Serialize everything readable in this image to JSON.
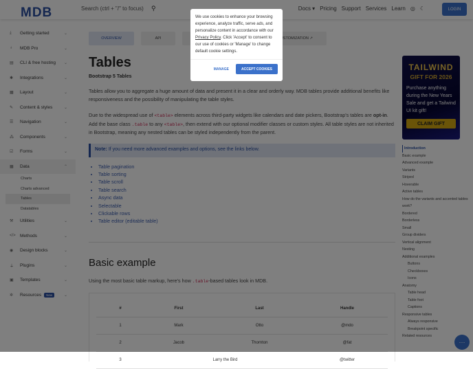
{
  "nav": {
    "logo": "MDB",
    "search_placeholder": "Search (ctrl + \"/\" to focus)",
    "links": [
      "Docs ▾",
      "Pricing",
      "Support",
      "Services",
      "Learn"
    ],
    "login": "LOGIN"
  },
  "sidebar": {
    "items": [
      {
        "label": "Getting started",
        "icon": "⤓"
      },
      {
        "label": "MDB Pro",
        "icon": "♁"
      },
      {
        "label": "CLI & free hosting",
        "icon": "▤"
      },
      {
        "label": "Integrations",
        "icon": "✱"
      },
      {
        "label": "Layout",
        "icon": "▦"
      },
      {
        "label": "Content & styles",
        "icon": "✎"
      },
      {
        "label": "Navigation",
        "icon": "☰"
      },
      {
        "label": "Components",
        "icon": "⁂"
      },
      {
        "label": "Forms",
        "icon": "☑"
      },
      {
        "label": "Data",
        "icon": "▦"
      }
    ],
    "data_sub": [
      "Charts",
      "Charts advanced",
      "Tables",
      "Datatables"
    ],
    "items2": [
      {
        "label": "Utilities",
        "icon": "⚒"
      },
      {
        "label": "Methods",
        "icon": "</>"
      },
      {
        "label": "Design blocks",
        "icon": "◉"
      },
      {
        "label": "Plugins",
        "icon": "⏚"
      },
      {
        "label": "Templates",
        "icon": "▣"
      },
      {
        "label": "Resources",
        "icon": "✲",
        "badge": "New"
      }
    ]
  },
  "tabs": [
    "OVERVIEW",
    "API",
    "",
    "CUSTOMIZATION ↗"
  ],
  "main": {
    "title": "Tables",
    "subtitle": "Bootstrap 5 Tables",
    "p1": "Tables allow you to aggregate a huge amount of data and present it in a clear and orderly way. MDB tables provide additional benefits like responsiveness and the possibility of manipulating the table styles.",
    "p2a": "Due to the widespread use of ",
    "p2code1": "<table>",
    "p2b": " elements across third-party widgets like calendars and date pickers, Bootstrap's tables are ",
    "p2bold": "opt-in",
    "p2c": ". Add the base class ",
    "p2code2": ".table",
    "p2d": " to any ",
    "p2code3": "<table>",
    "p2e": ", then extend with our optional modifier classes or custom styles. All table styles are not inherited in Bootstrap, meaning any nested tables can be styled independently from the parent.",
    "note_label": "Note:",
    "note_text": " If you need more advanced examples and options, see the links below.",
    "links": [
      "Table pagination",
      "Table sorting",
      "Table scroll",
      "Table search",
      "Async data",
      "Selectable",
      "Clickable rows",
      "Table editor (editable table)"
    ],
    "h2": "Basic example",
    "p3a": "Using the most basic table markup, here's how ",
    "p3code": ".table",
    "p3b": "-based tables look in MDB.",
    "table": {
      "headers": [
        "#",
        "First",
        "Last",
        "Handle"
      ],
      "rows": [
        [
          "1",
          "Mark",
          "Otto",
          "@mdo"
        ],
        [
          "2",
          "Jacob",
          "Thornton",
          "@fat"
        ],
        [
          "3",
          "Larry the Bird",
          "",
          "@twitter"
        ]
      ]
    }
  },
  "promo": {
    "t1": "TAILWIND",
    "t2": "GIFT FOR 2026",
    "desc": "Purchase anything during the New Years Sale and get a Tailwind UI kit gift!",
    "btn": "CLAIM GIFT"
  },
  "toc": [
    [
      "Introduction",
      0
    ],
    [
      "Basic example",
      0
    ],
    [
      "Advanced example",
      0
    ],
    [
      "Variants",
      0
    ],
    [
      "Striped",
      0
    ],
    [
      "Hoverable",
      0
    ],
    [
      "Active tables",
      0
    ],
    [
      "How do the variants and accented tables work?",
      0
    ],
    [
      "Bordered",
      0
    ],
    [
      "Borderless",
      0
    ],
    [
      "Small",
      0
    ],
    [
      "Group dividers",
      0
    ],
    [
      "Vertical alignment",
      0
    ],
    [
      "Nesting",
      0
    ],
    [
      "Additional examples",
      0
    ],
    [
      "Buttons",
      1
    ],
    [
      "Checkboxes",
      1
    ],
    [
      "Icons",
      1
    ],
    [
      "Anatomy",
      0
    ],
    [
      "Table head",
      1
    ],
    [
      "Table foot",
      1
    ],
    [
      "Captions",
      1
    ],
    [
      "Responsive tables",
      0
    ],
    [
      "Always responsive",
      1
    ],
    [
      "Breakpoint specific",
      1
    ],
    [
      "Related resources",
      0
    ]
  ],
  "cookie": {
    "text1": "We use cookies to enhance your browsing experience, analyze traffic, serve ads, and personalize content in accordance with our ",
    "link": "Privacy Policy",
    "text2": ". Click 'Accept' to consent to our use of cookies or 'Manage' to change default cookie settings.",
    "manage": "MANAGE",
    "accept": "ACCEPT COOKIES"
  }
}
